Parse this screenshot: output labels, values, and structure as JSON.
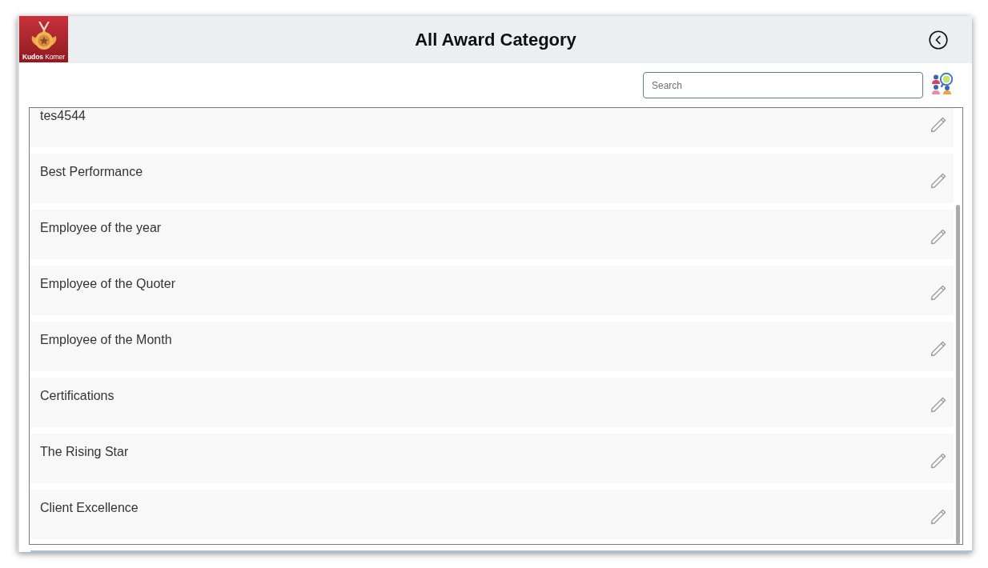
{
  "header": {
    "logo": {
      "text": "**Kudos** Korner"
    },
    "title": "All Award Category"
  },
  "search": {
    "placeholder": "Search"
  },
  "categories": [
    {
      "name": "tes4544"
    },
    {
      "name": "Best Performance"
    },
    {
      "name": "Employee of the year"
    },
    {
      "name": "Employee of the Quoter"
    },
    {
      "name": "Employee of the Month"
    },
    {
      "name": "Certifications"
    },
    {
      "name": "The Rising Star"
    },
    {
      "name": "Client Excellence"
    }
  ]
}
